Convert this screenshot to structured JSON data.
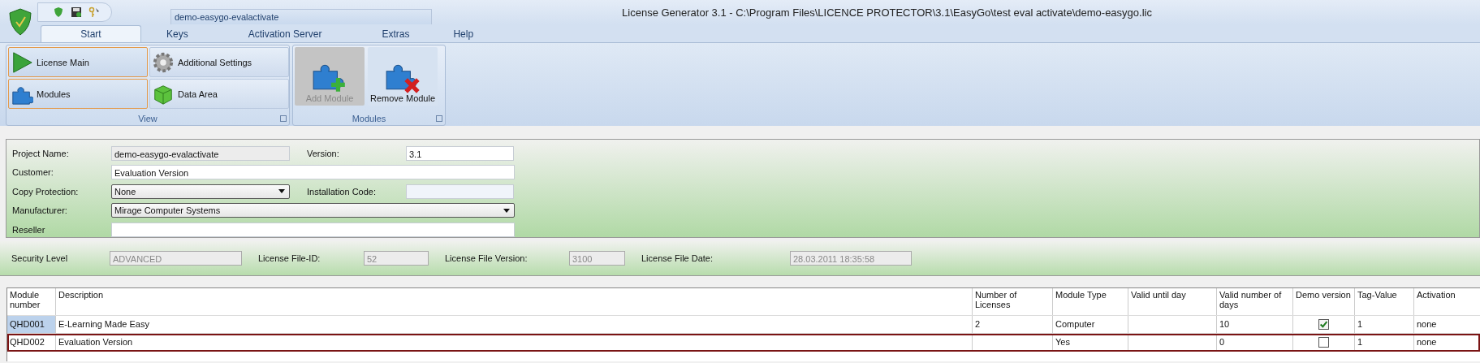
{
  "window": {
    "title": "License Generator 3.1 - C:\\Program Files\\LICENCE PROTECTOR\\3.1\\EasyGo\\test eval activate\\demo-easygo.lic",
    "context_tab": "demo-easygo-evalactivate"
  },
  "tabs": [
    {
      "label": "Start",
      "selected": true
    },
    {
      "label": "Keys",
      "selected": false
    },
    {
      "label": "Activation Server",
      "selected": false
    },
    {
      "label": "Extras",
      "selected": false
    },
    {
      "label": "Help",
      "selected": false
    }
  ],
  "ribbon": {
    "groups": [
      {
        "label": "View",
        "buttons": [
          {
            "label": "License Main",
            "selected": true
          },
          {
            "label": "Additional Settings",
            "selected": false
          },
          {
            "label": "Modules",
            "selected": true
          },
          {
            "label": "Data Area",
            "selected": false
          }
        ]
      },
      {
        "label": "Modules",
        "large_buttons": [
          {
            "label": "Add Module",
            "disabled": true
          },
          {
            "label": "Remove Module",
            "disabled": false
          }
        ]
      }
    ]
  },
  "project": {
    "fields": [
      {
        "label": "Project Name:",
        "value": "demo-easygo-evalactivate",
        "kind": "readonly"
      },
      {
        "label": "Version:",
        "value": "3.1",
        "kind": "text"
      },
      {
        "label": "Customer:",
        "value": "Evaluation Version",
        "kind": "text"
      },
      {
        "label": "Copy Protection:",
        "value": "None",
        "kind": "dropdown"
      },
      {
        "label": "Installation Code:",
        "kind": "empty"
      },
      {
        "label": "Manufacturer:",
        "value": "Mirage Computer Systems",
        "kind": "dropdown"
      },
      {
        "label": "Reseller",
        "kind": "text"
      }
    ]
  },
  "security": [
    {
      "label": "Security Level",
      "value": "ADVANCED",
      "disabled": true
    },
    {
      "label": "License File-ID:",
      "value": "52",
      "disabled": true
    },
    {
      "label": "License File Version:",
      "value": "3100",
      "disabled": true
    },
    {
      "label": "License File Date:",
      "value": "28.03.2011 18:35:58",
      "disabled": true
    }
  ],
  "table": {
    "columns": [
      "Module number",
      "Description",
      "Number of Licenses",
      "Module Type",
      "Valid until day",
      "Valid number of days",
      "Demo version",
      "Tag-Value",
      "Activation"
    ],
    "rows": [
      {
        "selected": true,
        "focused": false,
        "cells": [
          "QHD001",
          "E-Learning Made Easy",
          "2",
          "Computer",
          "",
          "10"
        ],
        "demo_version": true,
        "tail": [
          "1",
          "none"
        ]
      },
      {
        "selected": false,
        "focused": true,
        "cells": [
          "QHD002",
          "Evaluation Version",
          "",
          "Yes",
          "",
          "0"
        ],
        "demo_version": false,
        "tail": [
          "1",
          "none"
        ]
      }
    ]
  }
}
